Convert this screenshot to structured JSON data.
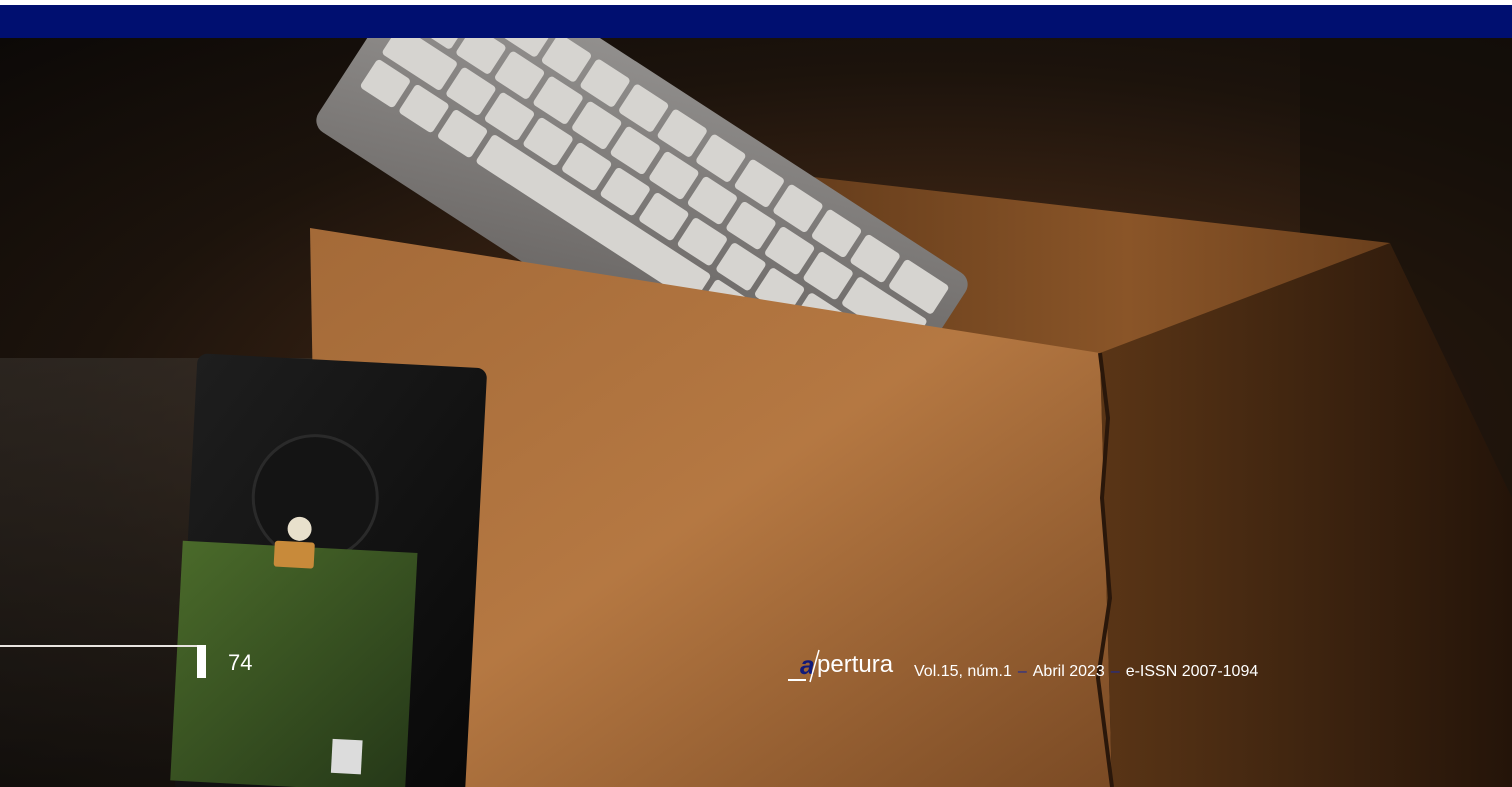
{
  "footer": {
    "page_number": "74",
    "logo": {
      "mark_letter": "a",
      "rest": "pertura"
    },
    "citation": {
      "volume": "Vol.15, núm.1",
      "date": "Abril 2023",
      "issn": "e-ISSN 2007-1094",
      "separator": "–"
    }
  },
  "colors": {
    "top_band": "#000f70",
    "logo_mark": "#101a7a",
    "text": "#ffffff"
  },
  "photo": {
    "subject": "keyboard-and-hard-drive-in-cardboard-box"
  }
}
